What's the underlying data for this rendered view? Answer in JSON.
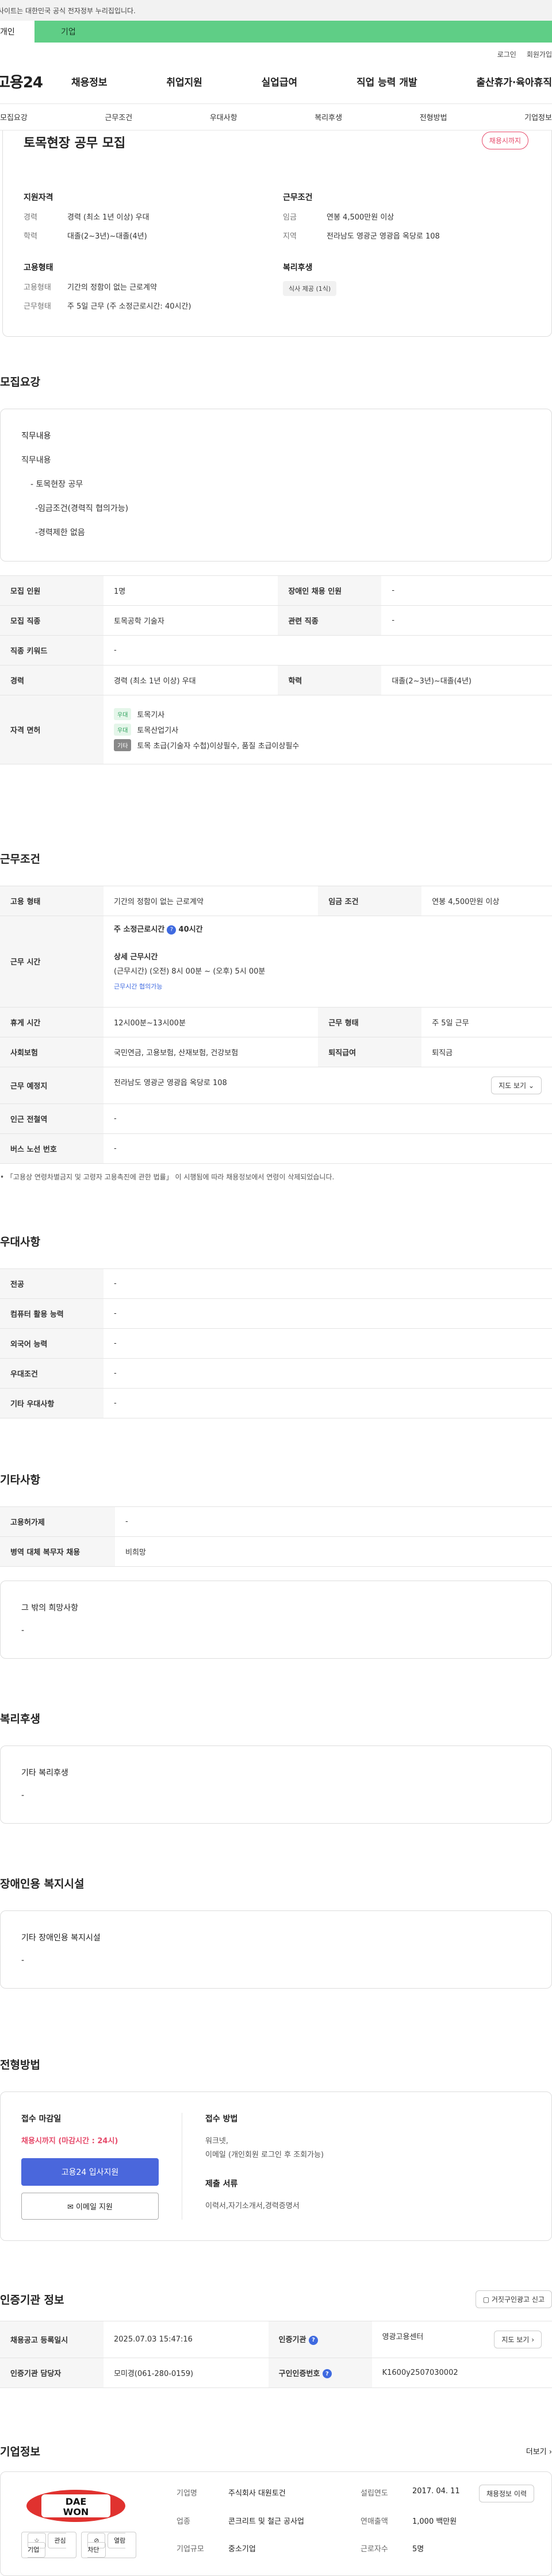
{
  "gov_notice": "사이트는 대한민국 공식 전자정부 누리집입니다.",
  "top_tabs": {
    "personal": "개인",
    "company": "기업"
  },
  "util_links": {
    "login": "로그인",
    "join": "회원가입"
  },
  "logo": "고용24",
  "gnb": [
    "채용정보",
    "취업지원",
    "실업급여",
    "직업 능력 개발",
    "출산휴가·육아휴직"
  ],
  "subnav": [
    "모집요강",
    "근무조건",
    "우대사항",
    "복리후생",
    "전형방법",
    "기업정보"
  ],
  "summary": {
    "title": "토목현장 공무 모집",
    "badge": "채용시까지",
    "qual_title": "지원자격",
    "qual_career_k": "경력",
    "qual_career_v": "경력 (최소 1년 이상) 우대",
    "qual_edu_k": "학력",
    "qual_edu_v": "대졸(2~3년)~대졸(4년)",
    "cond_title": "근무조건",
    "cond_wage_k": "임금",
    "cond_wage_v": "연봉 4,500만원 이상",
    "cond_area_k": "지역",
    "cond_area_v": "전라남도 영광군 영광읍 옥당로 108",
    "emp_title": "고용형태",
    "emp_type_k": "고용형태",
    "emp_type_v": "기간의 정함이 없는 근로계약",
    "emp_hours_k": "근무형태",
    "emp_hours_v": "주 5일 근무 (주 소정근로시간: 40시간)",
    "benefit_title": "복리후생",
    "benefit_chip": "식사 제공 (1식)"
  },
  "recruit": {
    "section": "모집요강",
    "duty_head": "직무내용",
    "duty_lines": [
      "직무내용",
      "- 토목현장 공무",
      "-임금조건(경력직 협의가능)",
      "-경력제한 없음"
    ],
    "rows": {
      "count_k": "모집 인원",
      "count_v": "1명",
      "disabled_k": "장애인 채용 인원",
      "disabled_v": "-",
      "job_k": "모집 직종",
      "job_v": "토목공학 기술자",
      "related_k": "관련 직종",
      "related_v": "-",
      "keyword_k": "직종 키워드",
      "keyword_v": "-",
      "career_k": "경력",
      "career_v": "경력 (최소 1년 이상) 우대",
      "edu_k": "학력",
      "edu_v": "대졸(2~3년)~대졸(4년)",
      "license_k": "자격 면허",
      "licenses": [
        {
          "tag": "우대",
          "name": "토목기사"
        },
        {
          "tag": "우대",
          "name": "토목산업기사"
        },
        {
          "tag": "기타",
          "name": "토목 초급(기술자 수첩)이상필수, 품질 초급이상필수"
        }
      ]
    }
  },
  "work": {
    "section": "근무조건",
    "emp_k": "고용 형태",
    "emp_v": "기간의 정함이 없는 근로계약",
    "wage_k": "임금 조건",
    "wage_v": "연봉 4,500만원 이상",
    "time_k": "근무 시간",
    "weekly": "주 소정근로시간",
    "weekly_v": "40시간",
    "detail_title": "상세 근무시간",
    "detail_v": "(근무시간) (오전) 8시 00분 ~ (오후) 5시 00분",
    "detail_link": "근무시간 협의가능",
    "rest_k": "휴게 시간",
    "rest_v": "12시00분~13시00분",
    "shift_k": "근무 형태",
    "shift_v": "주 5일 근무",
    "insurance_k": "사회보험",
    "insurance_v": "국민연금, 고용보험, 산재보험, 건강보험",
    "retire_k": "퇴직급여",
    "retire_v": "퇴직금",
    "place_k": "근무 예정지",
    "place_v": "전라남도 영광군 영광읍 옥당로 108",
    "map_btn": "지도 보기",
    "station_k": "인근 전철역",
    "station_v": "-",
    "bus_k": "버스 노선 번호",
    "bus_v": "-",
    "note": "「고용상 연령차별금지 및 고령자 고용촉진에 관한 법률」 이 시행됨에 따라 채용정보에서 연령이 삭제되었습니다."
  },
  "prefer": {
    "section": "우대사항",
    "major_k": "전공",
    "major_v": "-",
    "computer_k": "컴퓨터 활용 능력",
    "computer_v": "-",
    "lang_k": "외국어 능력",
    "lang_v": "-",
    "cond_k": "우대조건",
    "cond_v": "-",
    "etc_k": "기타 우대사항",
    "etc_v": "-"
  },
  "misc": {
    "section": "기타사항",
    "type_k": "고용허가제",
    "type_v": "-",
    "military_k": "병역 대체 복무자 채용",
    "military_v": "비희망",
    "other_title": "그 밖의 희망사항",
    "other_v": "-"
  },
  "welfare": {
    "section": "복리후생",
    "title": "기타 복리후생",
    "value": "-"
  },
  "disability": {
    "section": "장애인용 복지시설",
    "title": "기타 장애인용 복지시설",
    "value": "-"
  },
  "selection": {
    "section": "전형방법",
    "deadline_title": "접수 마감일",
    "deadline_v": "채용시까지 (마감시간 : 24시)",
    "apply_btn": "고용24 입사지원",
    "email_btn": "이메일 지원",
    "method_title": "접수 방법",
    "method_v1": "워크넷,",
    "method_v2": "이메일 (개인회원 로그인 후 조회가능)",
    "docs_title": "제출 서류",
    "docs_v": "이력서,자기소개서,경력증명서"
  },
  "cert": {
    "section": "인증기관 정보",
    "report_btn": "거짓구인광고 신고",
    "reg_k": "채용공고 등록일시",
    "reg_v": "2025.07.03 15:47:16",
    "agency_k": "인증기관",
    "agency_v": "영광고용센터",
    "map_btn": "지도 보기",
    "manager_k": "인증기관 담당자",
    "manager_v": "모미경(061-280-0159)",
    "no_k": "구인인증번호",
    "no_v": "K1600y2507030002"
  },
  "company": {
    "section": "기업정보",
    "more": "더보기",
    "logo_text": "DAE WON",
    "fav_btn": "관심기업",
    "block_btn": "열람차단",
    "name_k": "기업명",
    "name_v": "주식회사 대원토건",
    "industry_k": "업종",
    "industry_v": "콘크리트 및 철근 공사업",
    "size_k": "기업규모",
    "size_v": "중소기업",
    "founded_k": "설립연도",
    "founded_v": "2017. 04. 11",
    "sales_k": "연매출액",
    "sales_v": "1,000 백만원",
    "staff_k": "근로자수",
    "staff_v": "5명",
    "hist_btn": "채용정보 이력"
  }
}
